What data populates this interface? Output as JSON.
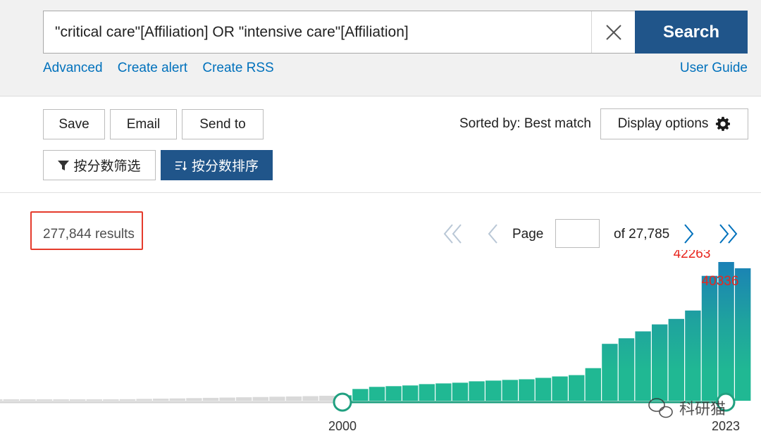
{
  "search": {
    "query": "\"critical care\"[Affiliation] OR \"intensive care\"[Affiliation]",
    "button_label": "Search",
    "links": [
      "Advanced",
      "Create alert",
      "Create RSS"
    ],
    "user_guide": "User Guide"
  },
  "toolbar": {
    "save_label": "Save",
    "email_label": "Email",
    "send_to_label": "Send to",
    "sorted_by": "Sorted by: Best match",
    "display_options_label": "Display options",
    "filter_label": "按分数筛选",
    "sort_label": "按分数排序"
  },
  "results": {
    "count_text": "277,844 results",
    "page_label": "Page",
    "page_value": "",
    "page_total_text": "of 27,785"
  },
  "colors": {
    "brand_blue": "#20558a",
    "link_blue": "#0071bc",
    "highlight_red": "#e53b2c",
    "bar_teal": "#20b893",
    "bar_blue": "#1a7eb8",
    "bar_gray": "#d9d9d9"
  },
  "icons": {
    "clear": "close-icon",
    "gear": "gear-icon",
    "filter": "filter-icon",
    "sort": "sort-icon",
    "first_page": "double-chevron-left-icon",
    "prev_page": "chevron-left-icon",
    "next_page": "chevron-right-icon",
    "last_page": "double-chevron-right-icon"
  },
  "chart_data": {
    "type": "bar",
    "series_gray_count": 21,
    "selected_range": [
      "2000",
      "2023"
    ],
    "values_relative": [
      0.004,
      0.004,
      0.005,
      0.005,
      0.006,
      0.007,
      0.008,
      0.009,
      0.011,
      0.013,
      0.015,
      0.017,
      0.019,
      0.021,
      0.023,
      0.025,
      0.027,
      0.029,
      0.031,
      0.033,
      0.036,
      0.039,
      0.085,
      0.1,
      0.105,
      0.11,
      0.12,
      0.125,
      0.13,
      0.14,
      0.145,
      0.15,
      0.155,
      0.165,
      0.175,
      0.185,
      0.235,
      0.41,
      0.45,
      0.5,
      0.55,
      0.59,
      0.65,
      0.9,
      1.0,
      0.955
    ],
    "data_labels": [
      {
        "bar_index": 44,
        "value": "42263"
      },
      {
        "bar_index": 45,
        "value": "40336"
      }
    ],
    "axis_ticks": [
      "2000",
      "2023"
    ],
    "watermark": "科研猫"
  }
}
